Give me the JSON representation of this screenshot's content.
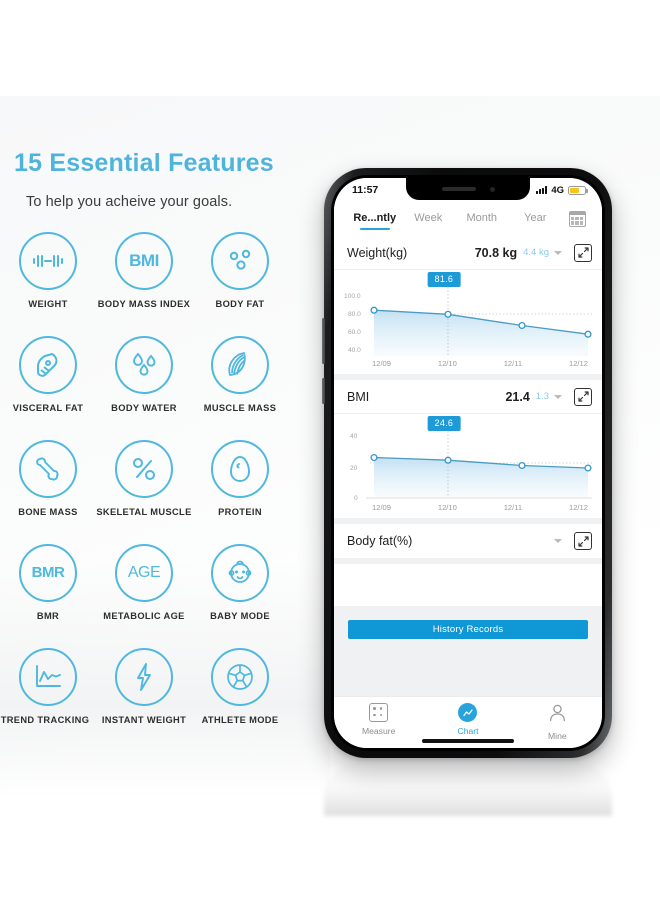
{
  "left_panel": {
    "headline": "15 Essential Features",
    "subhead": "To help you acheive your goals.",
    "accent_color": "#4FB4DC",
    "features": [
      {
        "icon": "dumbbell-icon",
        "label": "WEIGHT"
      },
      {
        "icon": "bmi-text-icon",
        "label": "BODY MASS INDEX",
        "glyph": "BMI"
      },
      {
        "icon": "body-fat-icon",
        "label": "BODY FAT"
      },
      {
        "icon": "visceral-fat-icon",
        "label": "VISCERAL FAT"
      },
      {
        "icon": "water-drops-icon",
        "label": "BODY WATER"
      },
      {
        "icon": "muscle-icon",
        "label": "MUSCLE MASS"
      },
      {
        "icon": "bone-icon",
        "label": "BONE MASS"
      },
      {
        "icon": "percent-icon",
        "label": "SKELETAL MUSCLE"
      },
      {
        "icon": "egg-icon",
        "label": "PROTEIN"
      },
      {
        "icon": "bmr-text-icon",
        "label": "BMR",
        "glyph": "BMR"
      },
      {
        "icon": "age-text-icon",
        "label": "METABOLIC AGE",
        "glyph": "AGE"
      },
      {
        "icon": "baby-face-icon",
        "label": "BABY MODE"
      },
      {
        "icon": "trend-chart-icon",
        "label": "TREND TRACKING"
      },
      {
        "icon": "lightning-icon",
        "label": "INSTANT WEIGHT"
      },
      {
        "icon": "soccer-ball-icon",
        "label": "ATHLETE MODE"
      }
    ]
  },
  "phone": {
    "status_bar": {
      "time": "11:57",
      "network": "4G",
      "signal_icon": "signal-bars-icon",
      "battery_icon": "battery-icon",
      "battery_color": "#F5C518"
    },
    "tabs": [
      {
        "label": "Re...ntly",
        "active": true
      },
      {
        "label": "Week",
        "active": false
      },
      {
        "label": "Month",
        "active": false
      },
      {
        "label": "Year",
        "active": false
      }
    ],
    "calendar_icon": "calendar-icon",
    "cards": [
      {
        "title": "Weight(kg)",
        "value": "70.8 kg",
        "delta": "4.4 kg",
        "caret_icon": "chevron-down-icon",
        "expand_icon": "expand-icon",
        "callout": "81.6"
      },
      {
        "title": "BMI",
        "value": "21.4",
        "delta": "1.3",
        "caret_icon": "chevron-down-icon",
        "expand_icon": "expand-icon",
        "callout": "24.6"
      },
      {
        "title": "Body fat(%)",
        "value": "",
        "delta": "",
        "caret_icon": "chevron-down-icon",
        "expand_icon": "expand-icon",
        "callout": ""
      }
    ],
    "history_button": "History Records",
    "bottom_nav": [
      {
        "label": "Measure",
        "icon": "scale-dots-icon",
        "active": false
      },
      {
        "label": "Chart",
        "icon": "chart-line-icon",
        "active": true
      },
      {
        "label": "Mine",
        "icon": "person-icon",
        "active": false
      }
    ],
    "accent_color": "#29A3DC",
    "button_color": "#0F97D6"
  },
  "chart_data": [
    {
      "type": "line",
      "title": "Weight(kg)",
      "x": [
        "12/09",
        "12/10",
        "12/11",
        "12/12"
      ],
      "values": [
        83.8,
        81.6,
        75.5,
        70.8
      ],
      "ylim": [
        30,
        105
      ],
      "yticks": [
        40.0,
        60.0,
        80.0,
        100.0
      ],
      "ytick_labels": [
        "40.0",
        "60.0",
        "80.0",
        "100.0"
      ],
      "xlabel": "",
      "ylabel": "",
      "grid": true,
      "legend": "none",
      "highlight_index": 1,
      "highlight_label": "81.6",
      "line_color": "#3B9FC6",
      "fill_color": "#CFE7F5"
    },
    {
      "type": "line",
      "title": "BMI",
      "x": [
        "12/09",
        "12/10",
        "12/11",
        "12/12"
      ],
      "values": [
        25.2,
        24.6,
        22.4,
        21.4
      ],
      "ylim": [
        0,
        45
      ],
      "yticks": [
        0,
        20,
        40
      ],
      "ytick_labels": [
        "0",
        "20",
        "40"
      ],
      "xlabel": "",
      "ylabel": "",
      "grid": true,
      "legend": "none",
      "highlight_index": 1,
      "highlight_label": "24.6",
      "line_color": "#3B9FC6",
      "fill_color": "#CFE7F5"
    }
  ]
}
